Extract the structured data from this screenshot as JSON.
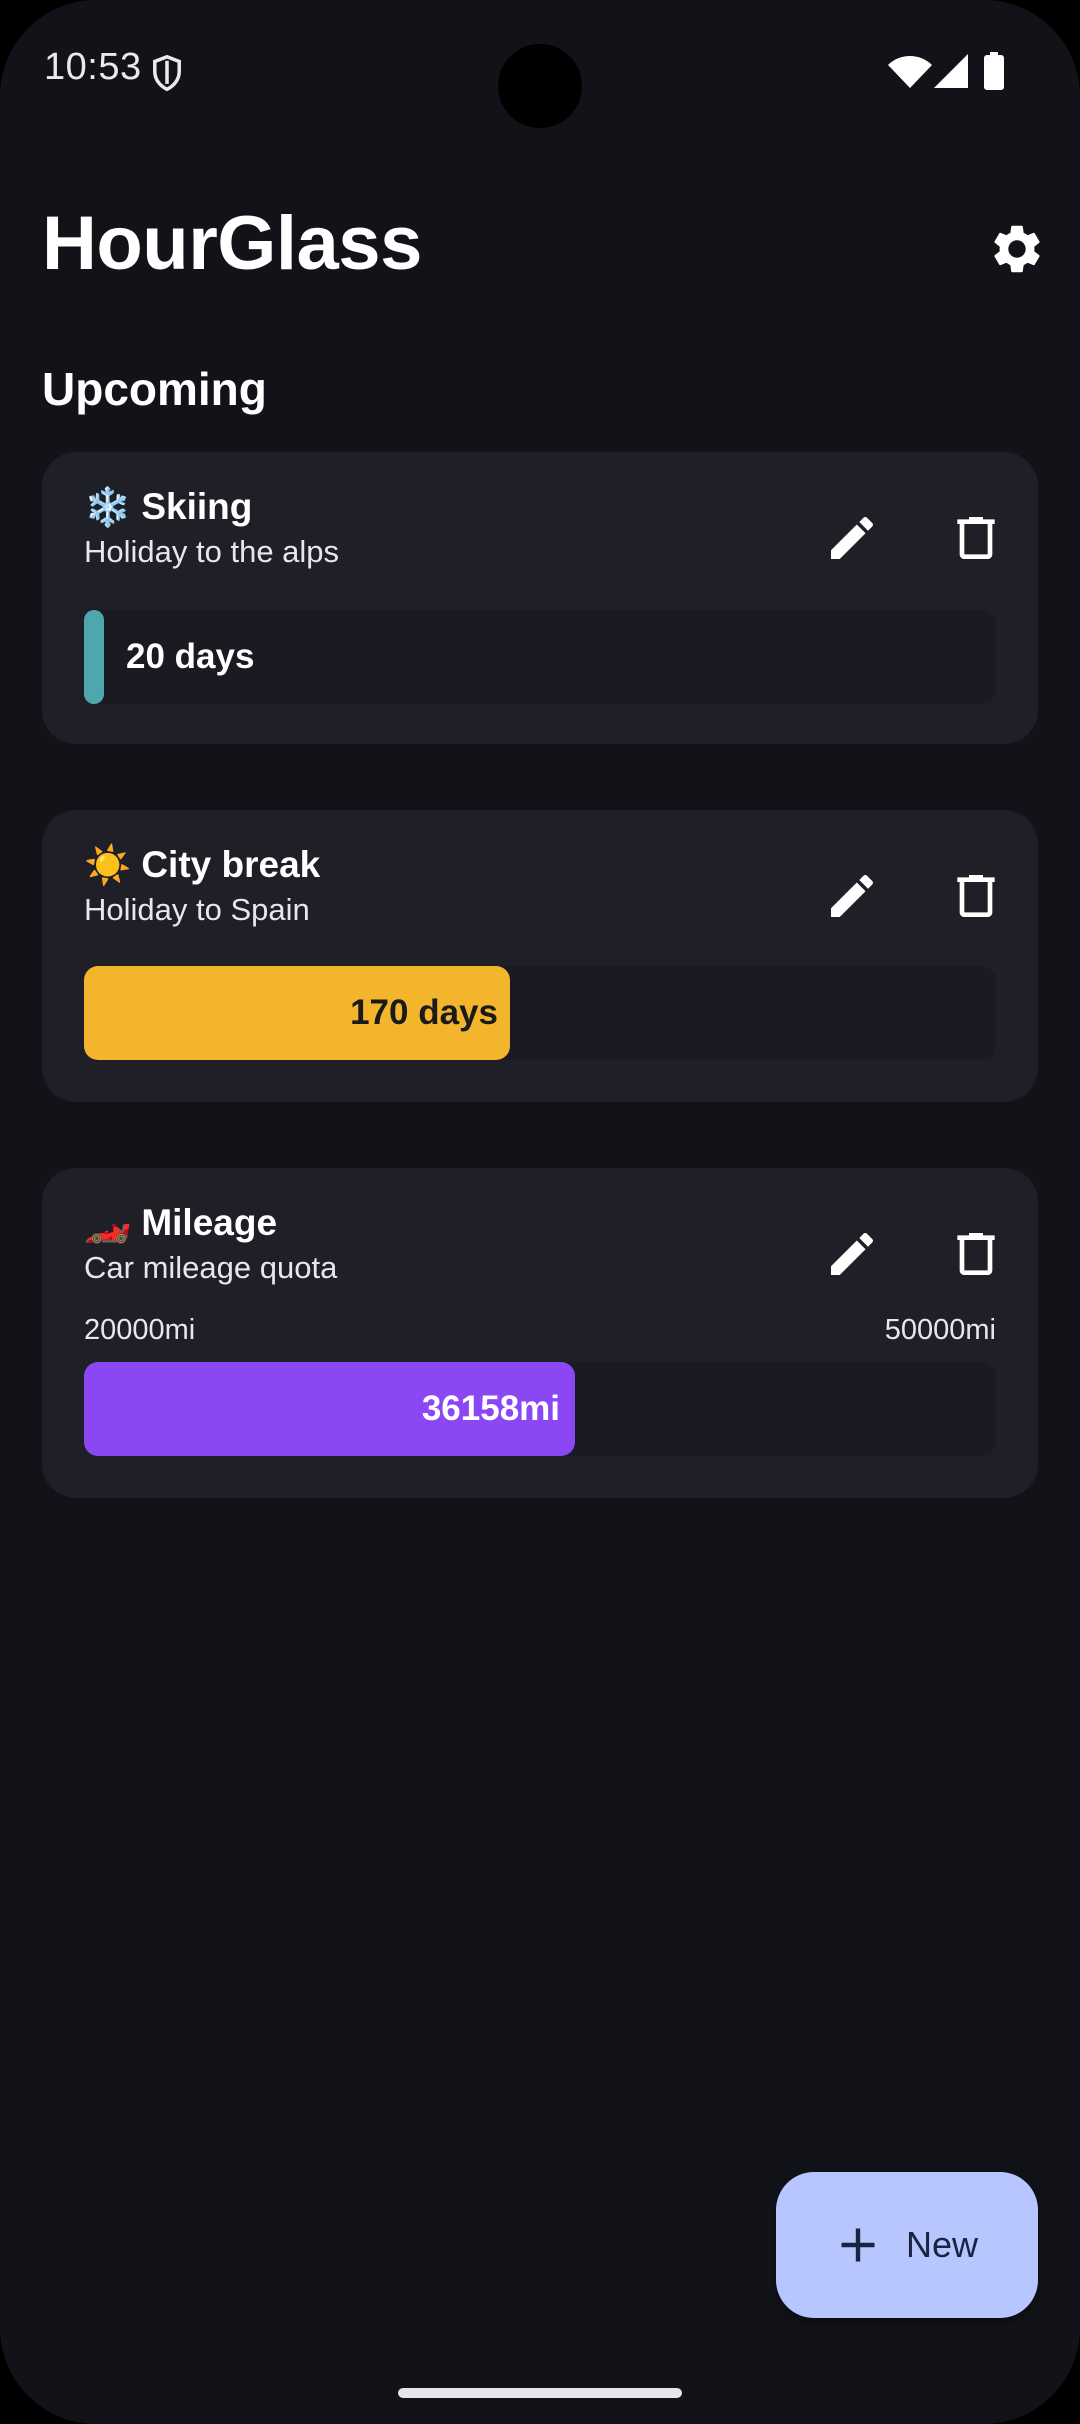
{
  "status_bar": {
    "time": "10:53"
  },
  "app": {
    "title": "HourGlass",
    "section_heading": "Upcoming",
    "settings_icon": "gear-icon"
  },
  "cards": [
    {
      "emoji": "❄️",
      "title": "Skiing",
      "subtitle": "Holiday to the alps",
      "bar_label": "20 days",
      "progress": 0.02,
      "color": "#4fa7ad"
    },
    {
      "emoji": "☀️",
      "title": "City break",
      "subtitle": "Holiday to Spain",
      "bar_label": "170 days",
      "progress": 0.47,
      "color": "#f2b52c"
    },
    {
      "emoji": "🏎️",
      "title": "Mileage",
      "subtitle": "Car mileage quota",
      "range_min": "20000mi",
      "range_max": "50000mi",
      "bar_label": "36158mi",
      "progress": 0.54,
      "color": "#8c47f5"
    }
  ],
  "fab": {
    "label": "New",
    "icon": "plus-icon"
  }
}
